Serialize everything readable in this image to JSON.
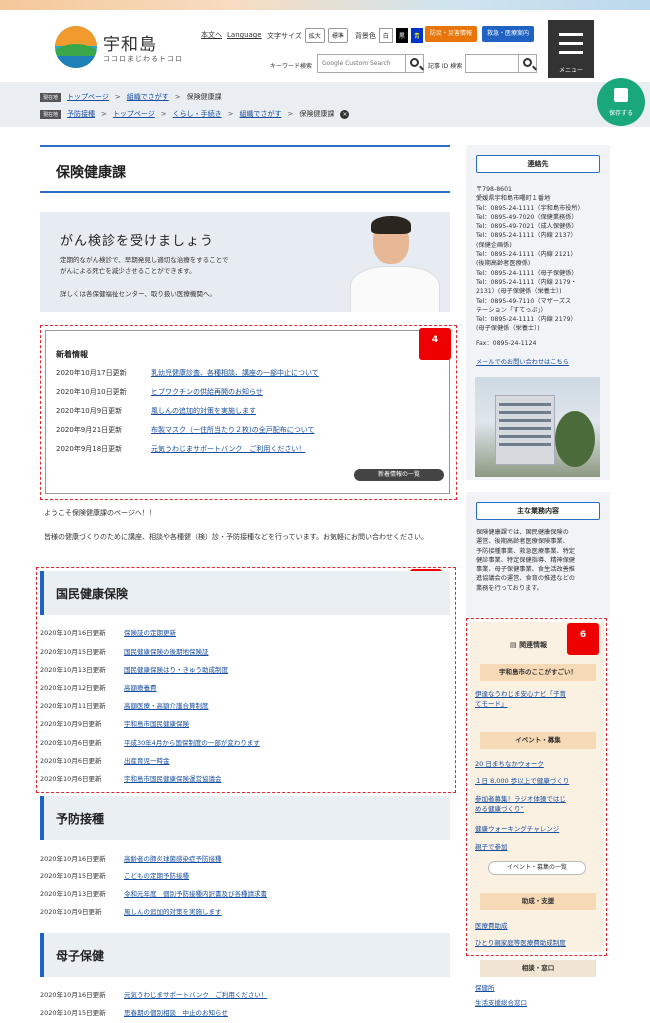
{
  "header": {
    "site_name": "宇和島",
    "site_sub": "ココロまじわるトコロ",
    "links": [
      "本文へ",
      "Language"
    ],
    "font_size_label": "文字サイズ",
    "font_large": "拡大",
    "font_normal": "標準",
    "bg_label": "背景色",
    "bg_white": "白",
    "bg_black": "黒",
    "bg_blue": "青",
    "disaster": "防災・災害情報",
    "medical": "救急・医療案内",
    "menu": "メニュー",
    "kw_label": "キーワード検索",
    "kw_placeholder": "Google Custom Search",
    "id_label": "記事 ID 検索"
  },
  "breadcrumb": {
    "now_tag": "現在地",
    "now": [
      "トップページ",
      "組織でさがす",
      "保険健康課"
    ],
    "path_tag": "現在地",
    "path": [
      "予防接種",
      "トップページ",
      "くらし・手続き",
      "組織でさがす",
      "保険健康課"
    ]
  },
  "save": "保存する",
  "page_title": "保険健康課",
  "banner": {
    "title": "がん検診を受けましょう",
    "text1": "定期的ながん検診で、早期発見し適切な治療をすることで",
    "text2": "がんによる死亡を減少させることができます。",
    "text3": "詳しくは各保健福祉センター、取り扱い医療機関へ。"
  },
  "news": {
    "title": "新着情報",
    "items": [
      {
        "date": "2020年10月17日更新",
        "text": "乳幼児健康診査、各種相談、講座の一部中止について"
      },
      {
        "date": "2020年10月10日更新",
        "text": "ヒブワクチンの供給再開のお知らせ"
      },
      {
        "date": "2020年10月9日更新",
        "text": "風しんの追加的対策を実施します"
      },
      {
        "date": "2020年9月21日更新",
        "text": "布製マスク（一住所当たり２枚)の全戸配布について"
      },
      {
        "date": "2020年9月18日更新",
        "text": "元気うわじまサポートバンク　ご利用ください！"
      }
    ],
    "all": "新着情報の一覧",
    "badge": "4"
  },
  "welcome1": "ようこそ保険健康課のページへ！！",
  "welcome2": "皆様の健康づくりのために講座、相談や各種健（検）診・予防接種などを行っています。お気軽にお問い合わせください。",
  "kokuho": {
    "title": "国民健康保険",
    "badge": "5",
    "items": [
      {
        "date": "2020年10月16日更新",
        "text": "保険証の定期更新"
      },
      {
        "date": "2020年10月15日更新",
        "text": "国民健康保険の後期地保険証"
      },
      {
        "date": "2020年10月13日更新",
        "text": "国民健康保険はり・きゅう助成制度"
      },
      {
        "date": "2020年10月12日更新",
        "text": "高額療養費"
      },
      {
        "date": "2020年10月11日更新",
        "text": "高額医療・高額介護合算制度"
      },
      {
        "date": "2020年10月9日更新",
        "text": "宇和島市国民健康保険"
      },
      {
        "date": "2020年10月6日更新",
        "text": "平成30年4月から国保制度の一部が変わります"
      },
      {
        "date": "2020年10月6日更新",
        "text": "出産育児一時金"
      },
      {
        "date": "2020年10月6日更新",
        "text": "宇和島市国民健康保険運営協議会"
      }
    ]
  },
  "yobo": {
    "title": "予防接種",
    "items": [
      {
        "date": "2020年10月16日更新",
        "text": "高齢者の肺炎球菌感染症予防接種"
      },
      {
        "date": "2020年10月15日更新",
        "text": "こどもの定期予防接種"
      },
      {
        "date": "2020年10月13日更新",
        "text": "令和元年度　個別予防接種内訳書及び各種請求書"
      },
      {
        "date": "2020年10月9日更新",
        "text": "風しんの追加的対策を実施します"
      }
    ]
  },
  "boshi": {
    "title": "母子保健",
    "items": [
      {
        "date": "2020年10月16日更新",
        "text": "元気うわじまサポートバンク　ご利用ください！"
      },
      {
        "date": "2020年10月15日更新",
        "text": "思春期の個別相談　中止のお知らせ"
      }
    ]
  },
  "contact": {
    "title": "連絡先",
    "text": "〒798-8601\n愛媛県宇和島市曙町１番地\nTel：0895-24-1111（宇和島市役所）\nTel：0895-49-7020（保健業務係）\nTel：0895-49-7021（成人保健係）\nTel：0895-24-1111（内線 2137）\n(保健企画係)\nTel：0895-24-1111（内線 2121）\n(後期高齢者医療係)\nTel：0895-24-1111（母子保健係）\nTel：0895-24-1111（内線 2179・\n2131）(母子保健係（栄養士）)\nTel：0895-49-7110（マザーズス\nテーション「すてっぷ」）\nTel：0895-24-1111（内線 2179）\n(母子保健係（栄養士）)",
    "fax": "Fax：0895-24-1124",
    "mail": "メールでのお問い合わせはこちら"
  },
  "duties": {
    "title": "主な業務内容",
    "text": "保険健康課では、国民健康保険の\n運営、後期高齢者医療保険事業、\n予防接種事業、救急医療事業、特定\n健診事業、特定保健指導、精神保健\n事業、母子保健事業、食生活改善推\n進協議会の運営、食育の推進などの\n業務を行っております。"
  },
  "related": {
    "title": "関連情報",
    "badge": "6",
    "sec1": "宇和島市のここがすごい！",
    "sec1_links": [
      "伊達なうわじま安心ナビ「子育",
      "てモード」"
    ],
    "sec2": "イベント・募集",
    "sec2_links": [
      "20 日まちなかウォーク",
      "１日 8,000 歩以上で健康づくり",
      "参加者募集！ラジオ体操ではじ",
      "める健康づくり”",
      "健康ウォーキングチャレンジ",
      "親子で参加"
    ],
    "sec2_btn": "イベント・募集の一覧",
    "sec3": "助成・支援",
    "sec3_links": [
      "医療費助成",
      "ひとり親家庭等医療費助成制度"
    ],
    "sec4": "相談・窓口",
    "sec4_links": [
      "保健所",
      "生活支援総合窓口"
    ]
  }
}
